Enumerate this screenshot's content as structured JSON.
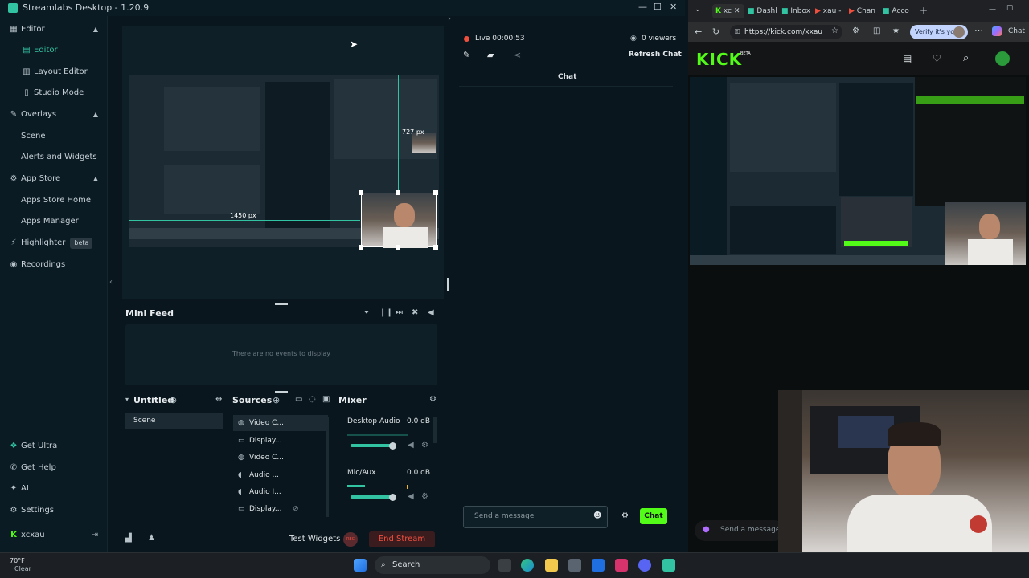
{
  "app": {
    "title": "Streamlabs Desktop - 1.20.9"
  },
  "sidebar": {
    "items": [
      {
        "label": "Editor",
        "icon": "editor-icon"
      },
      {
        "label": "Editor",
        "icon": "editor-sub-icon"
      },
      {
        "label": "Layout Editor",
        "icon": "layout-icon"
      },
      {
        "label": "Studio Mode",
        "icon": "studio-icon"
      },
      {
        "label": "Overlays",
        "icon": "overlays-icon"
      },
      {
        "label": "Scene"
      },
      {
        "label": "Alerts and Widgets"
      },
      {
        "label": "App Store",
        "icon": "app-store-icon"
      },
      {
        "label": "Apps Store Home"
      },
      {
        "label": "Apps Manager"
      },
      {
        "label": "Highlighter",
        "icon": "highlighter-icon"
      },
      {
        "label": "Recordings",
        "icon": "recordings-icon"
      }
    ],
    "beta_label": "beta",
    "bottom": [
      {
        "label": "Get Ultra"
      },
      {
        "label": "Get Help"
      },
      {
        "label": "AI"
      },
      {
        "label": "Settings"
      },
      {
        "label": "xcxau"
      }
    ]
  },
  "preview": {
    "measure_w": "727 px",
    "measure_h": "1450 px"
  },
  "minifeed": {
    "title": "Mini Feed",
    "empty": "There are no events to display"
  },
  "scenes": {
    "title": "Untitled",
    "items": [
      "Scene"
    ]
  },
  "sources": {
    "title": "Sources",
    "items": [
      "Video C...",
      "Display...",
      "Video C...",
      "Audio ...",
      "Audio I...",
      "Display..."
    ]
  },
  "mixer": {
    "title": "Mixer",
    "channels": [
      {
        "name": "Desktop Audio",
        "db": "0.0 dB",
        "level": 0.92
      },
      {
        "name": "Mic/Aux",
        "db": "0.0 dB",
        "level": 0.92
      }
    ]
  },
  "footer": {
    "test_widgets": "Test Widgets",
    "rec_label": "REC",
    "end_stream": "End Stream"
  },
  "stream": {
    "live": "Live 00:00:53",
    "viewers": "0 viewers",
    "refresh": "Refresh Chat",
    "chat_title": "Chat",
    "placeholder": "Send a message",
    "chat_button": "Chat"
  },
  "browser": {
    "tabs": [
      "xc",
      "Dashl",
      "Inbox",
      "xau -",
      "Chan",
      "Acco"
    ],
    "url": "https://kick.com/xxau",
    "verify": "Verify it's you",
    "chat_label": "Chat",
    "kick_logo": "KICK",
    "kick_beta": "BETA",
    "send_message": "Send a message"
  },
  "taskbar": {
    "weather_temp": "70°F",
    "weather_desc": "Clear",
    "search": "Search"
  },
  "colors": {
    "accent": "#31c3a2",
    "kick": "#53fc18",
    "live": "#f04f3e"
  }
}
